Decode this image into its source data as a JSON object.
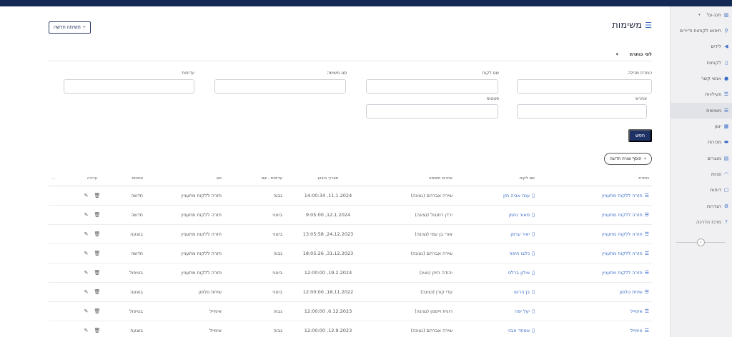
{
  "sidebar": {
    "items": [
      {
        "label": "תכנ-על",
        "icon": "chart-icon",
        "glyph": "▥"
      },
      {
        "label": "חיפוש לקוחות ודיירים",
        "icon": "search-icon",
        "glyph": "⚲"
      },
      {
        "label": "לידים",
        "icon": "megaphone-icon",
        "glyph": "◀"
      },
      {
        "label": "לקוחות",
        "icon": "building-icon",
        "glyph": "▯"
      },
      {
        "label": "אנשי קשר",
        "icon": "user-icon",
        "glyph": "●"
      },
      {
        "label": "פעילויות",
        "icon": "list-check-icon",
        "glyph": "☰"
      },
      {
        "label": "משימות",
        "icon": "tasks-icon",
        "glyph": "☰"
      },
      {
        "label": "יומן",
        "icon": "calendar-icon",
        "glyph": "▦"
      },
      {
        "label": "מכירות",
        "icon": "handshake-icon",
        "glyph": "⬬"
      },
      {
        "label": "מוצרים",
        "icon": "box-icon",
        "glyph": "▤"
      },
      {
        "label": "פניות",
        "icon": "headset-icon",
        "glyph": "◠"
      },
      {
        "label": "דוחות",
        "icon": "document-icon",
        "glyph": "▢"
      },
      {
        "label": "הגדרות",
        "icon": "gear-icon",
        "glyph": "⚙"
      },
      {
        "label": "מרכז הדרכה",
        "icon": "question-icon",
        "glyph": "?"
      }
    ],
    "toggle_glyph": "‹"
  },
  "page": {
    "title": "משימות",
    "title_glyph": "☰",
    "new_task": "משימה חדשה",
    "plus": "+"
  },
  "filter": {
    "mode": "לפי כותרת",
    "caret": "▾",
    "labels": {
      "title_contains": "כותרת מכילה",
      "customer_name": "שם לקוח",
      "task_type": "סוג משימה",
      "priority": "עדיפות",
      "owner": "אחראי",
      "status": "סטטוס"
    },
    "search_button": "חפש",
    "add_row": "הוסף שורה חדשה"
  },
  "table": {
    "headers": [
      "כותרת",
      "שם לקוח",
      "אחראי משימה",
      "תאריך ביצוע",
      "עדיפות - שם",
      "סוג",
      "סטטוס",
      "עריכה",
      "..."
    ],
    "rows": [
      [
        "חזרה ללקוח מתעניין",
        "ענת אביה חזן",
        "שירה אברהם (נציגה)",
        "11.1.2024, 14:00:34",
        "גבוה",
        "חזרה ללקוח מתעניין",
        "חדשה"
      ],
      [
        "חזרה ללקוח מתעניין",
        "מאור נחמן",
        "ירדן רוזנטל (נציגה)",
        "12.1.2024, 9:05:00",
        "בינוני",
        "חזרה ללקוח מתעניין",
        "חדשה"
      ],
      [
        "חזרה ללקוח מתעניין",
        "יאיר ערמן",
        "אורי בן עמי (נציגה)",
        "24.12.2023, 13:05:58",
        "בינוני",
        "חזרה ללקוח מתעניין",
        "בוצעה"
      ],
      [
        "חזרה ללקוח מתעניין",
        "כלבו חיפה",
        "שירה אברהם (נציגה)",
        "31.12.2023, 18:05:26",
        "גבוה",
        "חזרה ללקוח מתעניין",
        "חדשה"
      ],
      [
        "חזרה ללקוח מתעניין",
        "אילון ברלס",
        "יהודה הייזן (נציג)",
        "19.2.2024, 12:00:00",
        "בינוני",
        "חזרה ללקוח מתעניין",
        "בטיפול"
      ],
      [
        "שיחת טלפון",
        "בן הרוש",
        "עדי קורן (נציגה)",
        "18.11.2022, 12:00:00",
        "בינוני",
        "שיחת טלפון",
        "בוצעה"
      ],
      [
        "אימייל",
        "יעל יפה",
        "רונית וייסמן (נציגה)",
        "6.12.2023, 12:00:00",
        "גבוה",
        "אימייל",
        "בטיפול"
      ],
      [
        "אימייל",
        "אסתר אבני",
        "שירה אברהם (נציגה)",
        "12.9.2023, 12:00:00",
        "גבוה",
        "אימייל",
        "בוצעה"
      ]
    ],
    "row_glyph": "☰",
    "cust_glyph": "▯",
    "edit_glyph": "✎",
    "delete_glyph": "🗑"
  }
}
